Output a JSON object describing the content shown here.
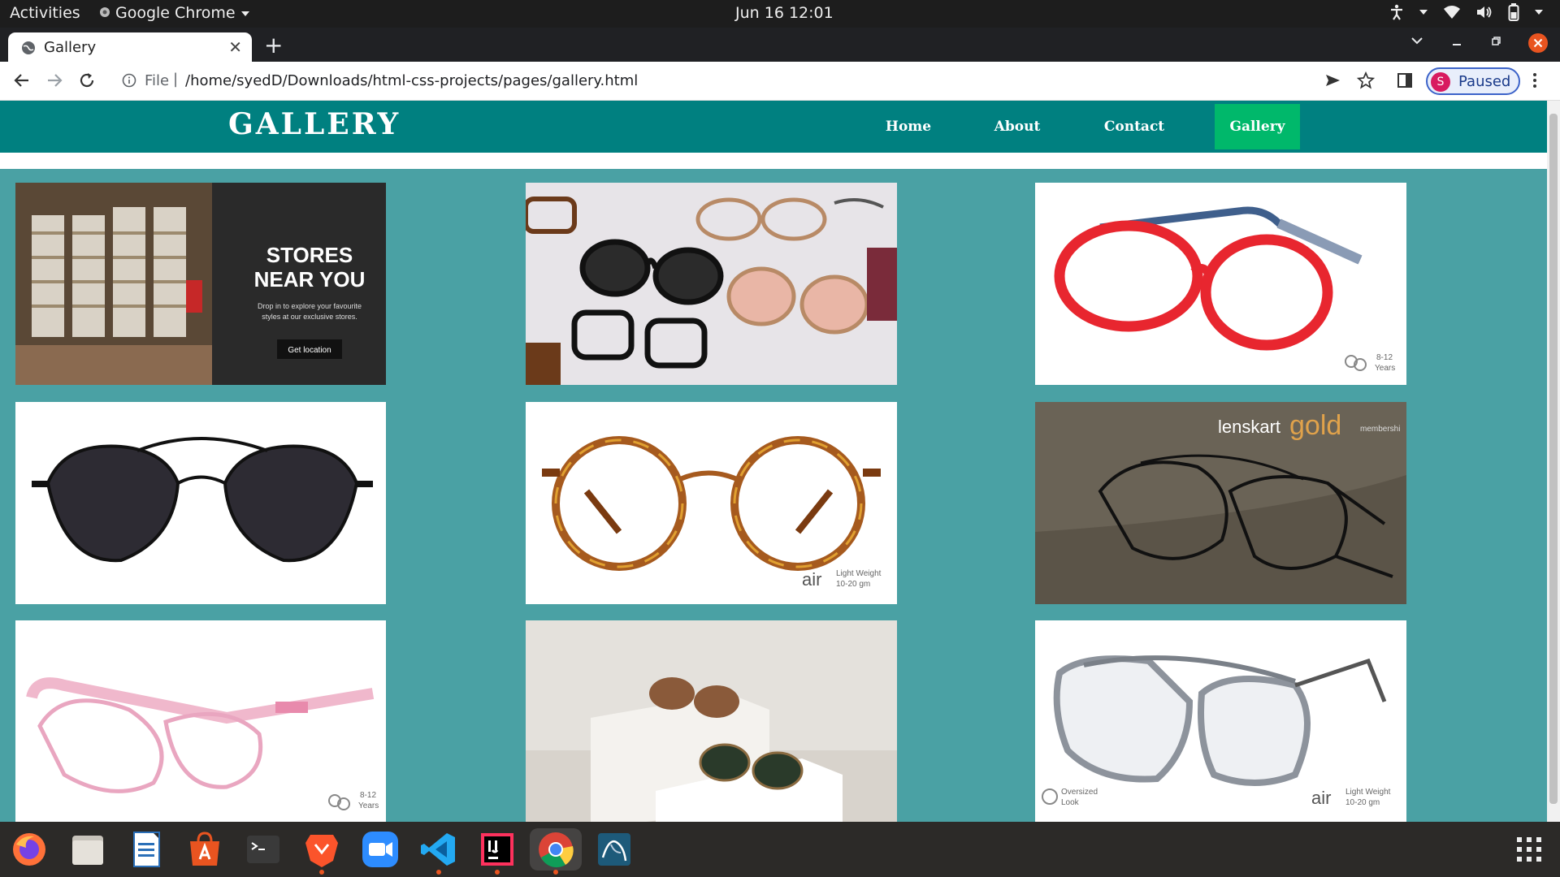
{
  "system": {
    "activities": "Activities",
    "app_name": "Google Chrome",
    "clock": "Jun 16  12:01"
  },
  "browser": {
    "tab_title": "Gallery",
    "url_scheme": "File",
    "url_separator": "|",
    "url": "/home/syedD/Downloads/html-css-projects/pages/gallery.html",
    "profile_initial": "S",
    "profile_status": "Paused"
  },
  "site": {
    "title": "GALLERY",
    "nav": [
      {
        "label": "Home"
      },
      {
        "label": "About"
      },
      {
        "label": "Contact"
      },
      {
        "label": "Gallery",
        "active": true
      }
    ],
    "store_tile": {
      "heading_line1": "STORES",
      "heading_line2": "NEAR YOU",
      "body_line1": "Drop in to explore your favourite",
      "body_line2": "styles at our exclusive stores.",
      "cta": "Get location"
    },
    "badges": {
      "age_line1": "8-12",
      "age_line2": "Years",
      "air": "air",
      "light_line1": "Light Weight",
      "light_line2": "10-20 gm",
      "oversized_line1": "Oversized",
      "oversized_line2": "Look",
      "lenskart_brand": "lenskart",
      "lenskart_gold": "gold",
      "lenskart_membership": "membershi"
    }
  },
  "colors": {
    "header": "#008080",
    "page_background": "#4aa1a4",
    "nav_active": "#00b86b"
  },
  "dock_icons": [
    "firefox-icon",
    "files-icon",
    "writer-icon",
    "software-icon",
    "terminal-icon",
    "brave-icon",
    "zoom-icon",
    "vscode-icon",
    "intellij-icon",
    "chrome-icon",
    "mysql-workbench-icon",
    "show-apps-icon"
  ]
}
